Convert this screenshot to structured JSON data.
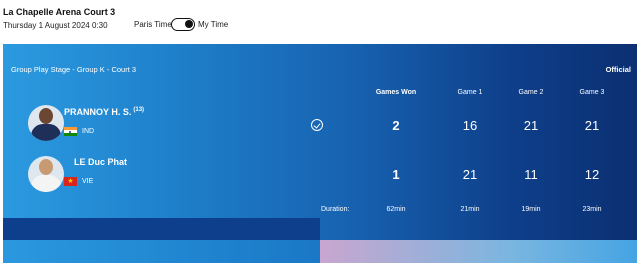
{
  "header": {
    "venue": "La Chapelle Arena Court 3",
    "datetime": "Thursday 1 August 2024 0:30",
    "timezone_left": "Paris Time",
    "timezone_right": "My Time",
    "toggle_state": "My Time"
  },
  "match": {
    "stage": "Group Play Stage - Group K - Court 3",
    "status": "Official",
    "columns": [
      "Games Won",
      "Game 1",
      "Game 2",
      "Game 3"
    ],
    "players": [
      {
        "name": "PRANNOY H. S.",
        "seed": "(13)",
        "country": "IND",
        "winner": true,
        "games_won": "2",
        "games": [
          "16",
          "21",
          "21"
        ]
      },
      {
        "name": "LE Duc Phat",
        "seed": "",
        "country": "VIE",
        "winner": false,
        "games_won": "1",
        "games": [
          "21",
          "11",
          "12"
        ]
      }
    ],
    "duration_label": "Duration:",
    "durations": [
      "62min",
      "21min",
      "19min",
      "23min"
    ]
  },
  "icons": {
    "winner": "check-circle-icon",
    "flag_ind": "india-flag-icon",
    "flag_vie": "vietnam-flag-icon"
  },
  "colors": {
    "card_light": "#2b9ae0",
    "card_dark": "#0b2f72",
    "text": "#ffffff"
  }
}
